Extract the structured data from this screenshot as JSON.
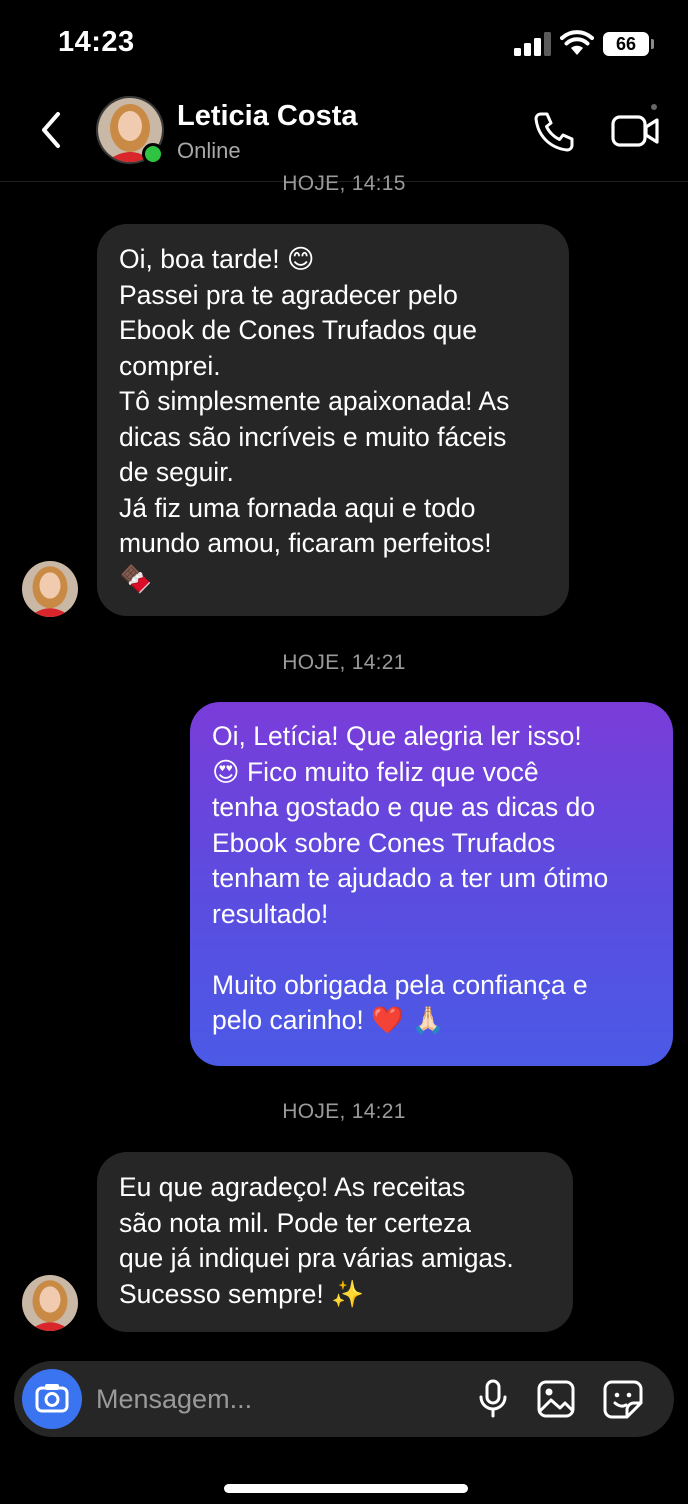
{
  "status_bar": {
    "time": "14:23",
    "battery": "66",
    "icons": [
      "signal-icon",
      "wifi-icon",
      "battery-icon"
    ]
  },
  "header": {
    "name": "Leticia Costa",
    "status": "Online",
    "icons": [
      "back-icon",
      "avatar",
      "call-icon",
      "video-icon"
    ],
    "colors": {
      "online": "#2ec441"
    }
  },
  "messages": [
    {
      "type": "timestamp",
      "text": "HOJE, 14:15"
    },
    {
      "type": "incoming",
      "text": "Oi, boa tarde! 😊\nPassei pra te agradecer pelo\nEbook de Cones Trufados que\ncomprei.\nTô simplesmente apaixonada! As\ndicas são incríveis e muito fáceis\nde seguir.\nJá fiz uma fornada aqui e todo\nmundo amou, ficaram perfeitos!\n🍫"
    },
    {
      "type": "timestamp",
      "text": "HOJE, 14:21"
    },
    {
      "type": "outgoing",
      "text": "Oi, Letícia! Que alegria ler isso!\n😍 Fico muito feliz que você\ntenha gostado e que as dicas do\nEbook sobre Cones Trufados\ntenham te ajudado a ter um ótimo\nresultado!\n\nMuito obrigada pela confiança e\npelo carinho! ❤️ 🙏🏻"
    },
    {
      "type": "timestamp",
      "text": "HOJE, 14:21"
    },
    {
      "type": "incoming",
      "text": "Eu que agradeço! As receitas\nsão nota mil. Pode ter certeza\nque já indiquei pra várias amigas.\nSucesso sempre! ✨"
    }
  ],
  "composer": {
    "placeholder": "Mensagem...",
    "icons": [
      "camera-icon",
      "mic-icon",
      "gallery-icon",
      "sticker-icon"
    ],
    "colors": {
      "camera": "#3a74f0",
      "bubble_out_top": "#7a3cd9",
      "bubble_out_bottom": "#4b5ae6",
      "bubble_in": "#262626"
    }
  }
}
